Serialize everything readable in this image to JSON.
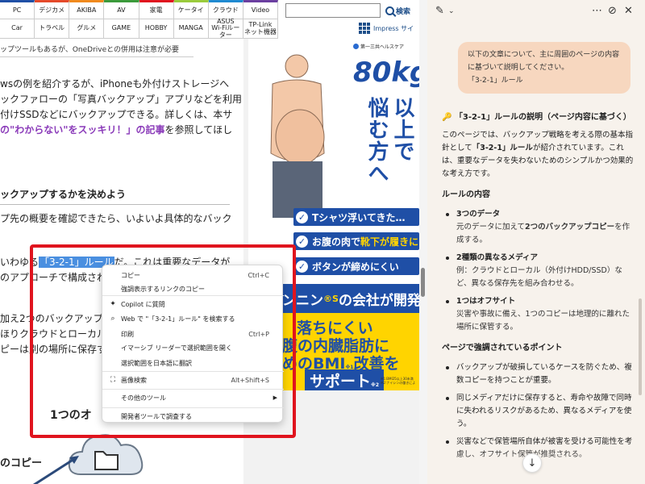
{
  "nav": {
    "row1": [
      "PC",
      "デジカメ",
      "AKIBA",
      "AV",
      "家電",
      "ケータイ",
      "クラウド",
      "Video"
    ],
    "row2": [
      "Car",
      "トラベル",
      "グルメ",
      "GAME",
      "HOBBY",
      "MANGA",
      "ASUS\nWi-Fiルーター",
      "TP-Link\nネット機器"
    ],
    "row1_colors": [
      "#1f4fa6",
      "#e54a2a",
      "#f08a1d",
      "#3b9a3b",
      "#e0141e",
      "#9acb3c",
      "#1f8ad1",
      "#6b3fa0"
    ],
    "search_label": "検索",
    "impress_label": "Impress サイ"
  },
  "article": {
    "note": "ップツールもあるが、OneDriveとの併用は注意が必要",
    "p1_l1": "wsの例を紹介するが、iPhoneも外付けストレージへ",
    "p1_l2": "ックファローの「写真バックアップ」アプリなどを利用",
    "p1_l3": "付けSSDなどにバックアップできる。詳しくは、本サ",
    "p1_l4_link": "の\"わからない\"をスッキリ！」の記事",
    "p1_l4_rest": "を参照してほし",
    "h3": "ックアップするかを決めよう",
    "p2_l1": "プ先の概要を確認できたら、いよいよ具体的なバック",
    "p3_pre": "いわゆる",
    "p3_highlight": "「3-2-1」ルール",
    "p3_post": "だ。これは重要なデータが",
    "p3_l2": "のアプローチで構成され",
    "p4_l1": "加え2つのバックアップ",
    "p4_l2": "ほりクラウドとローカルな",
    "p4_l3": "ピーは別の場所に保存す",
    "diagram_title": "1つのオ",
    "diagram_left": "のコピー"
  },
  "ad": {
    "sponsor": "第一三共ヘルスケア",
    "headline_big": "80kg",
    "headline_col1": "以上で",
    "headline_col2": "悩む方へ",
    "bar1": "Tシャツ浮いてきた…",
    "bar2_pre": "お腹の肉で",
    "bar2_yellow": "靴下が履きにくい",
    "bar3": "ボタンが締めにくい",
    "company_pre": "ンニン",
    "company_mark": "®S",
    "company_post": "の会社が開発",
    "y1": "落ちにくい",
    "y2": "腹の内臓脂肪に",
    "y3": "めのBMI",
    "y3_sup": "※1",
    "y3_post": "改善を",
    "y4": "サポート",
    "y4_sup": "※2",
    "fine1": "※1:BMI25以上30未満",
    "fine2": "※2:ナイシンの働きによ"
  },
  "copilot": {
    "user_message": "以下の文章について、主に周囲のページの内容に基づいて説明してください。\n「3-2-1」ルール",
    "title": "「3-2-1」ルールの説明（ページ内容に基づく）",
    "intro_pre": "このページでは、バックアップ戦略を考える際の基本指針として",
    "intro_bold": "「3-2-1」ルール",
    "intro_post": "が紹介されています。これは、重要なデータを失わないためのシンプルかつ効果的な考え方です。",
    "h1": "ルールの内容",
    "rules": [
      {
        "head": "3つのデータ",
        "body_pre": "元のデータに加えて",
        "body_bold": "2つのバックアップコピー",
        "body_post": "を作成する。"
      },
      {
        "head": "2種類の異なるメディア",
        "body_pre": "例：クラウドとローカル（外付けHDD/SSD）など、異なる保存先を組み合わせる。",
        "body_bold": "",
        "body_post": ""
      },
      {
        "head": "1つはオフサイト",
        "body_pre": "災害や事故に備え、1つのコピーは地理的に離れた場所に保管する。",
        "body_bold": "",
        "body_post": ""
      }
    ],
    "h2": "ページで強調されているポイント",
    "points": [
      "バックアップが破損しているケースを防ぐため、複数コピーを持つことが重要。",
      "同じメディアだけに保存すると、寿命や故障で同時に失われるリスクがあるため、異なるメディアを使う。",
      "災害などで保管場所自体が被害を受ける可能性を考慮し、オフサイト保管が推奨される。"
    ]
  },
  "context_menu": {
    "items": [
      {
        "icon": "",
        "icon_name": "none",
        "label": "コピー",
        "shortcut": "Ctrl+C",
        "arrow": ""
      },
      {
        "icon": "",
        "icon_name": "none",
        "label": "強調表示するリンクのコピー",
        "shortcut": "",
        "arrow": ""
      },
      {
        "icon": "✦",
        "icon_name": "copilot-icon",
        "label": "Copilot に質問",
        "shortcut": "",
        "arrow": ""
      },
      {
        "icon": "⌕",
        "icon_name": "search-icon",
        "label": "Web で \"「3-2-1」ルール\" を検索する",
        "shortcut": "",
        "arrow": ""
      },
      {
        "icon": "",
        "icon_name": "none",
        "label": "印刷",
        "shortcut": "Ctrl+P",
        "arrow": ""
      },
      {
        "icon": "",
        "icon_name": "none",
        "label": "イマーシブ リーダーで選択範囲を開く",
        "shortcut": "",
        "arrow": ""
      },
      {
        "icon": "",
        "icon_name": "none",
        "label": "選択範囲を日本語に翻訳",
        "shortcut": "",
        "arrow": ""
      },
      {
        "icon": "⛶",
        "icon_name": "visual-search-icon",
        "label": "画像検索",
        "shortcut": "Alt+Shift+S",
        "arrow": ""
      },
      {
        "icon": "",
        "icon_name": "none",
        "label": "その他のツール",
        "shortcut": "",
        "arrow": "▶"
      },
      {
        "icon": "",
        "icon_name": "none",
        "label": "開発者ツールで調査する",
        "shortcut": "",
        "arrow": ""
      }
    ]
  }
}
